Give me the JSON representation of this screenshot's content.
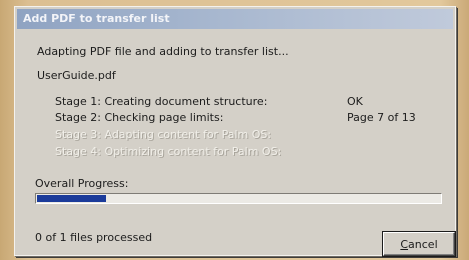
{
  "window": {
    "title": "Add PDF to transfer list"
  },
  "status": {
    "heading": "Adapting PDF file and adding to transfer list...",
    "filename": "UserGuide.pdf"
  },
  "stages": [
    {
      "label": "Stage 1: Creating document structure:",
      "status": "OK",
      "enabled": true
    },
    {
      "label": "Stage 2: Checking page limits:",
      "status": "Page 7 of 13",
      "enabled": true
    },
    {
      "label": "Stage 3: Adapting content for Palm OS:",
      "status": "",
      "enabled": false
    },
    {
      "label": "Stage 4: Optimizing content for Palm OS:",
      "status": "",
      "enabled": false
    }
  ],
  "progress": {
    "label": "Overall Progress:",
    "fraction": 0.17,
    "fill_color": "#1b3b9a"
  },
  "footer": {
    "files_processed": "0 of 1 files processed",
    "cancel_label": "Cancel",
    "cancel_mnemonic": "C"
  }
}
